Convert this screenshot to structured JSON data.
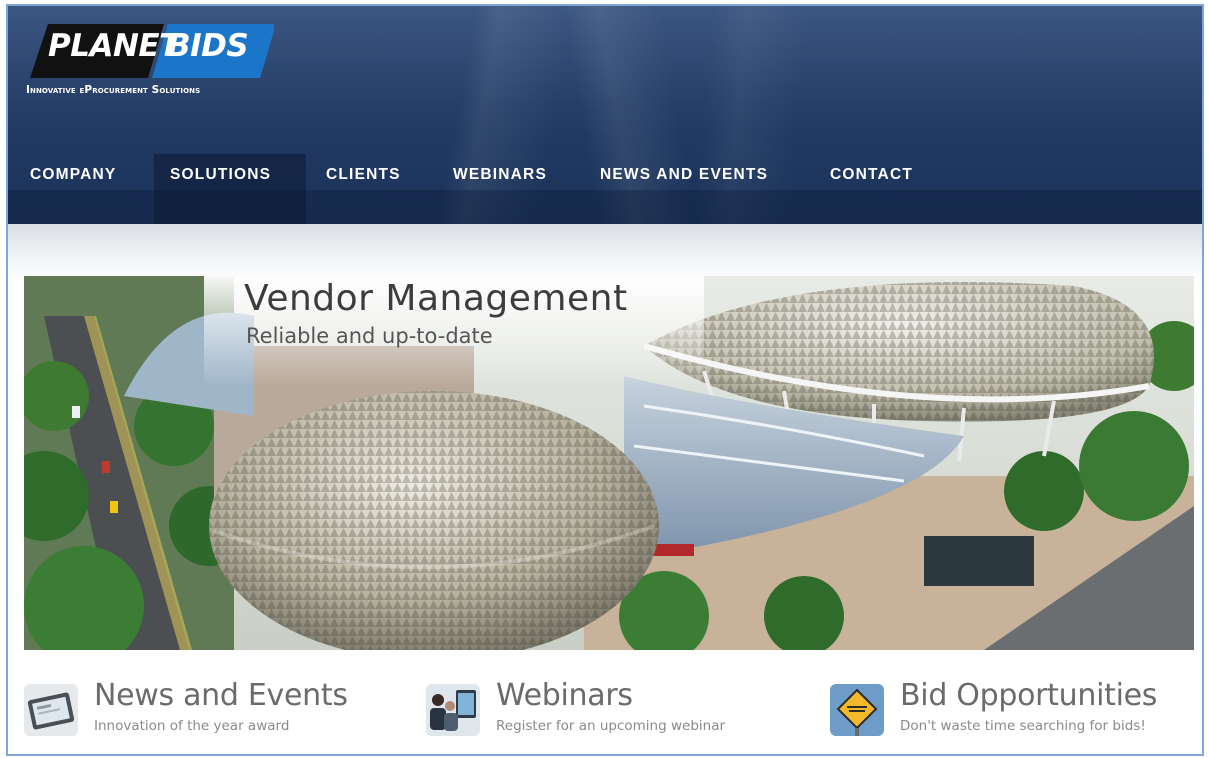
{
  "brand": {
    "logo_planet": "PLANET",
    "logo_bids": "BIDS",
    "tagline": "Innovative eProcurement Solutions",
    "colors": {
      "logo_black": "#111111",
      "logo_blue": "#1b75c9",
      "header": "#233c66"
    }
  },
  "nav": {
    "items": [
      {
        "label": "COMPANY"
      },
      {
        "label": "SOLUTIONS",
        "active": true
      },
      {
        "label": "CLIENTS"
      },
      {
        "label": "WEBINARS"
      },
      {
        "label": "NEWS AND EVENTS"
      },
      {
        "label": "CONTACT"
      }
    ]
  },
  "hero": {
    "title": "Vendor Management",
    "subtitle": "Reliable and up-to-date",
    "image": "aerial-photo-of-esplanade-theatres-domes"
  },
  "features": [
    {
      "icon": "tablet-news-icon",
      "title": "News and Events",
      "desc": "Innovation of the year award"
    },
    {
      "icon": "webinar-people-icon",
      "title": "Webinars",
      "desc": "Register for an upcoming webinar"
    },
    {
      "icon": "bid-sign-icon",
      "title": "Bid Opportunities",
      "desc": "Don't waste time searching for bids!"
    }
  ]
}
